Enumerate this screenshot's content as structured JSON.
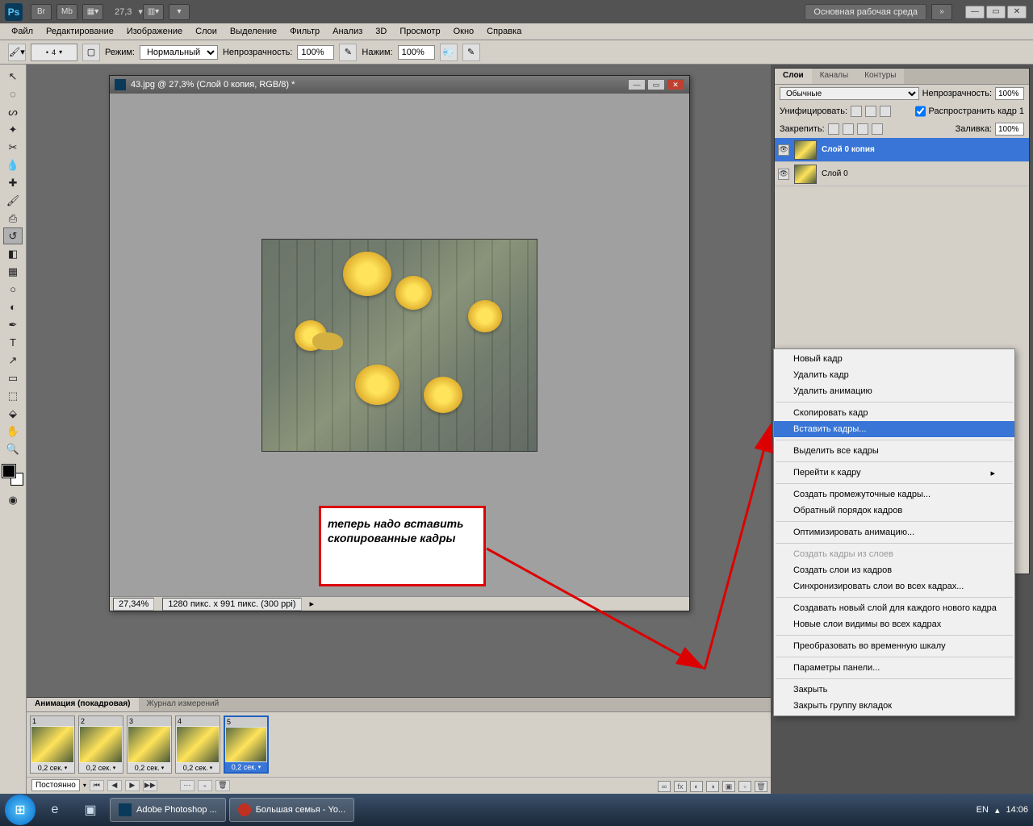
{
  "titlebar": {
    "zoom": "27,3",
    "workspace": "Основная рабочая среда"
  },
  "menubar": [
    "Файл",
    "Редактирование",
    "Изображение",
    "Слои",
    "Выделение",
    "Фильтр",
    "Анализ",
    "3D",
    "Просмотр",
    "Окно",
    "Справка"
  ],
  "optbar": {
    "brush_size": "4",
    "mode_label": "Режим:",
    "mode_value": "Нормальный",
    "opacity_label": "Непрозрачность:",
    "opacity_value": "100%",
    "flow_label": "Нажим:",
    "flow_value": "100%"
  },
  "document": {
    "title": "43.jpg @ 27,3% (Слой 0 копия, RGB/8) *",
    "zoom": "27,34%",
    "info": "1280 пикс. x 991 пикс. (300 ppi)"
  },
  "annotation": "теперь надо вставить скопированные кадры",
  "layers_panel": {
    "tabs": [
      "Слои",
      "Каналы",
      "Контуры"
    ],
    "blend": "Обычные",
    "opacity_lbl": "Непрозрачность:",
    "opacity": "100%",
    "unify_lbl": "Унифицировать:",
    "propagate_lbl": "Распространить кадр 1",
    "lock_lbl": "Закрепить:",
    "fill_lbl": "Заливка:",
    "fill": "100%",
    "layers": [
      {
        "name": "Слой 0 копия",
        "selected": true
      },
      {
        "name": "Слой 0",
        "selected": false
      }
    ]
  },
  "context_menu": [
    {
      "t": "Новый кадр"
    },
    {
      "t": "Удалить кадр"
    },
    {
      "t": "Удалить анимацию"
    },
    {
      "sep": true
    },
    {
      "t": "Скопировать кадр"
    },
    {
      "t": "Вставить кадры...",
      "hov": true
    },
    {
      "sep": true
    },
    {
      "t": "Выделить все кадры"
    },
    {
      "sep": true
    },
    {
      "t": "Перейти к кадру",
      "arr": true
    },
    {
      "sep": true
    },
    {
      "t": "Создать промежуточные кадры..."
    },
    {
      "t": "Обратный порядок кадров"
    },
    {
      "sep": true
    },
    {
      "t": "Оптимизировать анимацию..."
    },
    {
      "sep": true
    },
    {
      "t": "Создать кадры из слоев",
      "dis": true
    },
    {
      "t": "Создать слои из кадров"
    },
    {
      "t": "Синхронизировать слои во всех кадрах..."
    },
    {
      "sep": true
    },
    {
      "t": "Создавать новый слой для каждого нового кадра"
    },
    {
      "t": "Новые слои видимы во всех кадрах"
    },
    {
      "sep": true
    },
    {
      "t": "Преобразовать во временную шкалу"
    },
    {
      "sep": true
    },
    {
      "t": "Параметры панели..."
    },
    {
      "sep": true
    },
    {
      "t": "Закрыть"
    },
    {
      "t": "Закрыть группу вкладок"
    }
  ],
  "animation": {
    "tabs": [
      "Анимация (покадровая)",
      "Журнал измерений"
    ],
    "frames": [
      {
        "n": "1",
        "t": "0,2 сек."
      },
      {
        "n": "2",
        "t": "0,2 сек."
      },
      {
        "n": "3",
        "t": "0,2 сек."
      },
      {
        "n": "4",
        "t": "0,2 сек."
      },
      {
        "n": "5",
        "t": "0,2 сек.",
        "sel": true
      }
    ],
    "loop": "Постоянно"
  },
  "taskbar": {
    "tasks": [
      {
        "label": "Adobe Photoshop ...",
        "color": "#0a3a5a"
      },
      {
        "label": "Большая семья - Yo...",
        "color": "#c03020"
      }
    ],
    "lang": "EN",
    "time": "14:06"
  }
}
